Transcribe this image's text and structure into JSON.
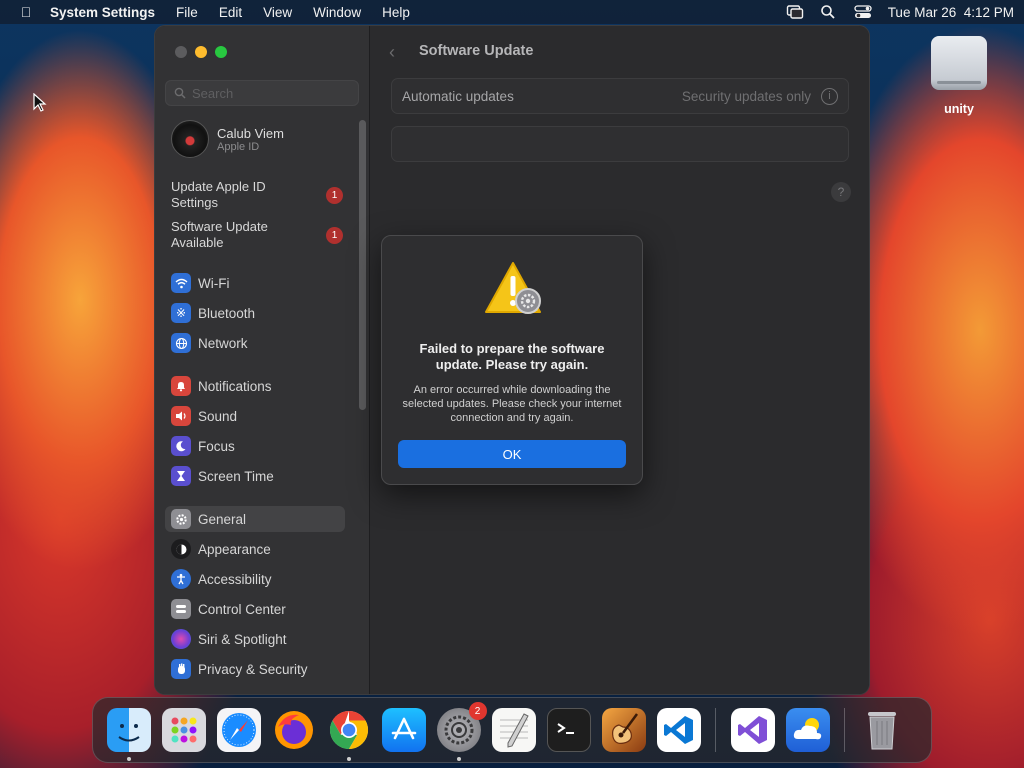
{
  "menubar": {
    "app_name": "System Settings",
    "items": [
      "File",
      "Edit",
      "View",
      "Window",
      "Help"
    ],
    "clock": "Tue Mar 26  4:12 PM"
  },
  "desktop": {
    "drive_label": "unity"
  },
  "window": {
    "search_placeholder": "Search",
    "profile": {
      "name": "Calub Viem",
      "subtitle": "Apple ID"
    },
    "notices": [
      {
        "text": "Update Apple ID Settings",
        "badge": "1"
      },
      {
        "text": "Software Update Available",
        "badge": "1"
      }
    ],
    "sidebar_items": [
      {
        "label": "Wi-Fi",
        "icon": "wifi-icon",
        "color": "#2f6fd6"
      },
      {
        "label": "Bluetooth",
        "icon": "bluetooth-icon",
        "color": "#2f6fd6"
      },
      {
        "label": "Network",
        "icon": "globe-icon",
        "color": "#2f6fd6"
      },
      {
        "label": "Notifications",
        "icon": "bell-icon",
        "color": "#d8463c"
      },
      {
        "label": "Sound",
        "icon": "speaker-icon",
        "color": "#d8463c"
      },
      {
        "label": "Focus",
        "icon": "moon-icon",
        "color": "#5a4fcf"
      },
      {
        "label": "Screen Time",
        "icon": "hourglass-icon",
        "color": "#5a4fcf"
      },
      {
        "label": "General",
        "icon": "gear-icon",
        "color": "#8e8e93"
      },
      {
        "label": "Appearance",
        "icon": "appearance-icon",
        "color": "#1c1c1e"
      },
      {
        "label": "Accessibility",
        "icon": "accessibility-icon",
        "color": "#2f6fd6"
      },
      {
        "label": "Control Center",
        "icon": "control-center-icon",
        "color": "#8e8e93"
      },
      {
        "label": "Siri & Spotlight",
        "icon": "siri-icon",
        "color": "#b04ad0"
      },
      {
        "label": "Privacy & Security",
        "icon": "hand-icon",
        "color": "#2f6fd6"
      }
    ],
    "main": {
      "title": "Software Update",
      "automatic_label": "Automatic updates",
      "automatic_value": "Security updates only"
    }
  },
  "dialog": {
    "title": "Failed to prepare the software update. Please try again.",
    "message": "An error occurred while downloading the selected updates. Please check your internet connection and try again.",
    "ok_label": "OK"
  },
  "dock": {
    "apps": [
      "finder-icon",
      "launchpad-icon",
      "safari-icon",
      "firefox-icon",
      "chrome-icon",
      "app-store-icon",
      "system-settings-icon",
      "textedit-icon",
      "terminal-icon",
      "garageband-icon",
      "vscode-icon",
      "visual-studio-icon",
      "weather-icon",
      "trash-icon"
    ],
    "settings_badge": "2"
  }
}
